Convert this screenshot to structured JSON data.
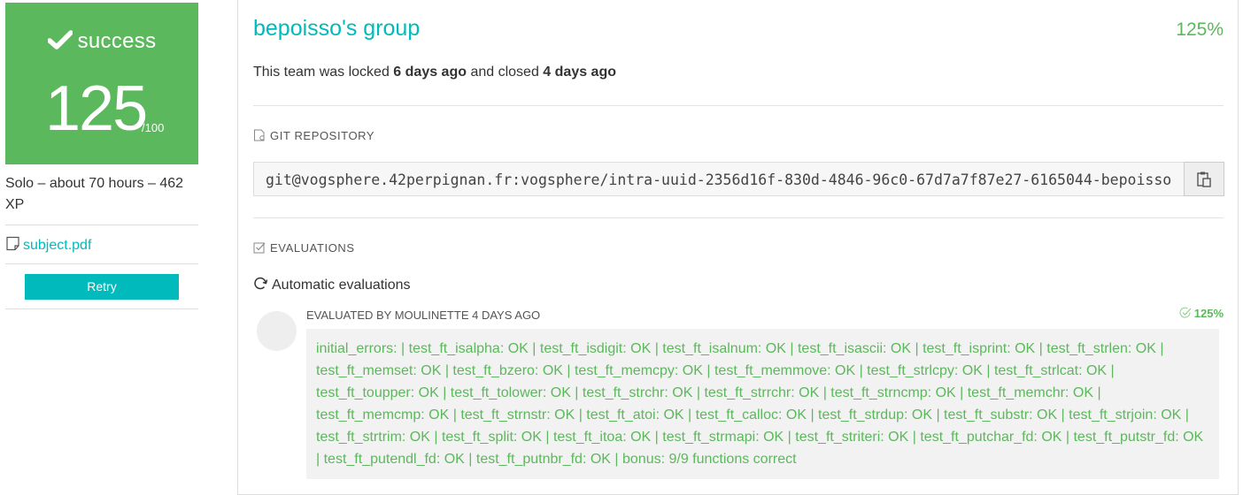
{
  "sidebar": {
    "status_label": "success",
    "score": "125",
    "score_max": "/100",
    "info": "Solo – about 70 hours – 462 XP",
    "subject_link": "subject.pdf",
    "retry_label": "Retry"
  },
  "team": {
    "title": "bepoisso's group",
    "final_mark": "125%",
    "lock_prefix": "This team was locked",
    "locked_ago": "6 days ago",
    "lock_middle": "and closed",
    "closed_ago": "4 days ago"
  },
  "repository": {
    "section_label": "GIT REPOSITORY",
    "url": "git@vogsphere.42perpignan.fr:vogsphere/intra-uuid-2356d16f-830d-4846-96c0-67d7a7f87e27-6165044-bepoisso"
  },
  "evaluations": {
    "section_label": "EVALUATIONS",
    "automatic_label": "Automatic evaluations",
    "evaluated_by": "EVALUATED BY MOULINETTE 4 DAYS AGO",
    "score": "125%",
    "output": "initial_errors: | test_ft_isalpha: OK | test_ft_isdigit: OK | test_ft_isalnum: OK | test_ft_isascii: OK | test_ft_isprint: OK | test_ft_strlen: OK | test_ft_memset: OK | test_ft_bzero: OK | test_ft_memcpy: OK | test_ft_memmove: OK | test_ft_strlcpy: OK | test_ft_strlcat: OK | test_ft_toupper: OK | test_ft_tolower: OK | test_ft_strchr: OK | test_ft_strrchr: OK | test_ft_strncmp: OK | test_ft_memchr: OK | test_ft_memcmp: OK | test_ft_strnstr: OK | test_ft_atoi: OK | test_ft_calloc: OK | test_ft_strdup: OK | test_ft_substr: OK | test_ft_strjoin: OK | test_ft_strtrim: OK | test_ft_split: OK | test_ft_itoa: OK | test_ft_strmapi: OK | test_ft_striteri: OK | test_ft_putchar_fd: OK | test_ft_putstr_fd: OK | test_ft_putendl_fd: OK | test_ft_putnbr_fd: OK | bonus: 9/9 functions correct"
  },
  "colors": {
    "success_green": "#5cb85c",
    "accent_teal": "#00babc"
  },
  "icons": {
    "status": "check-icon",
    "subject": "document-icon",
    "repository": "repository-icon",
    "copy": "clipboard-icon",
    "evaluations": "checkbox-icon",
    "automatic": "refresh-icon",
    "eval_score": "check-circle-icon"
  }
}
